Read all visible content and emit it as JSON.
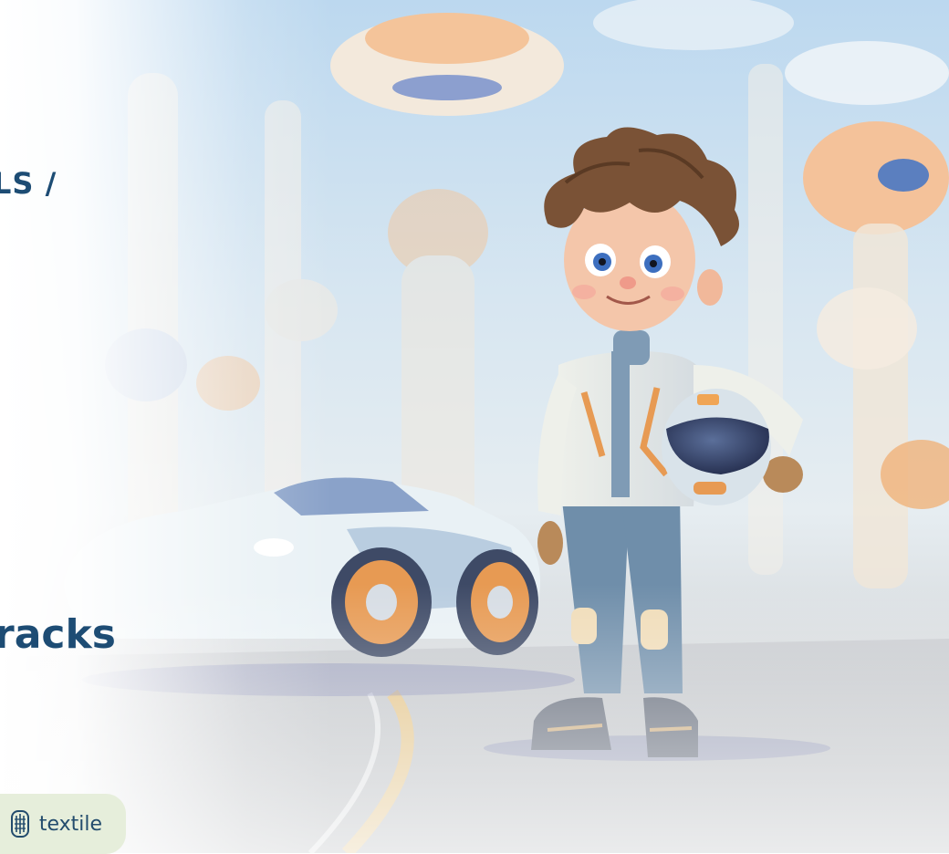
{
  "header": {
    "category_fragment": "LS /"
  },
  "hero": {
    "title_fragment": "racks"
  },
  "tag": {
    "label": "textile",
    "icon": "textile-icon"
  },
  "colors": {
    "heading": "#1d4c74",
    "tag_background": "#e6eedb",
    "tag_text": "#234c6d"
  }
}
